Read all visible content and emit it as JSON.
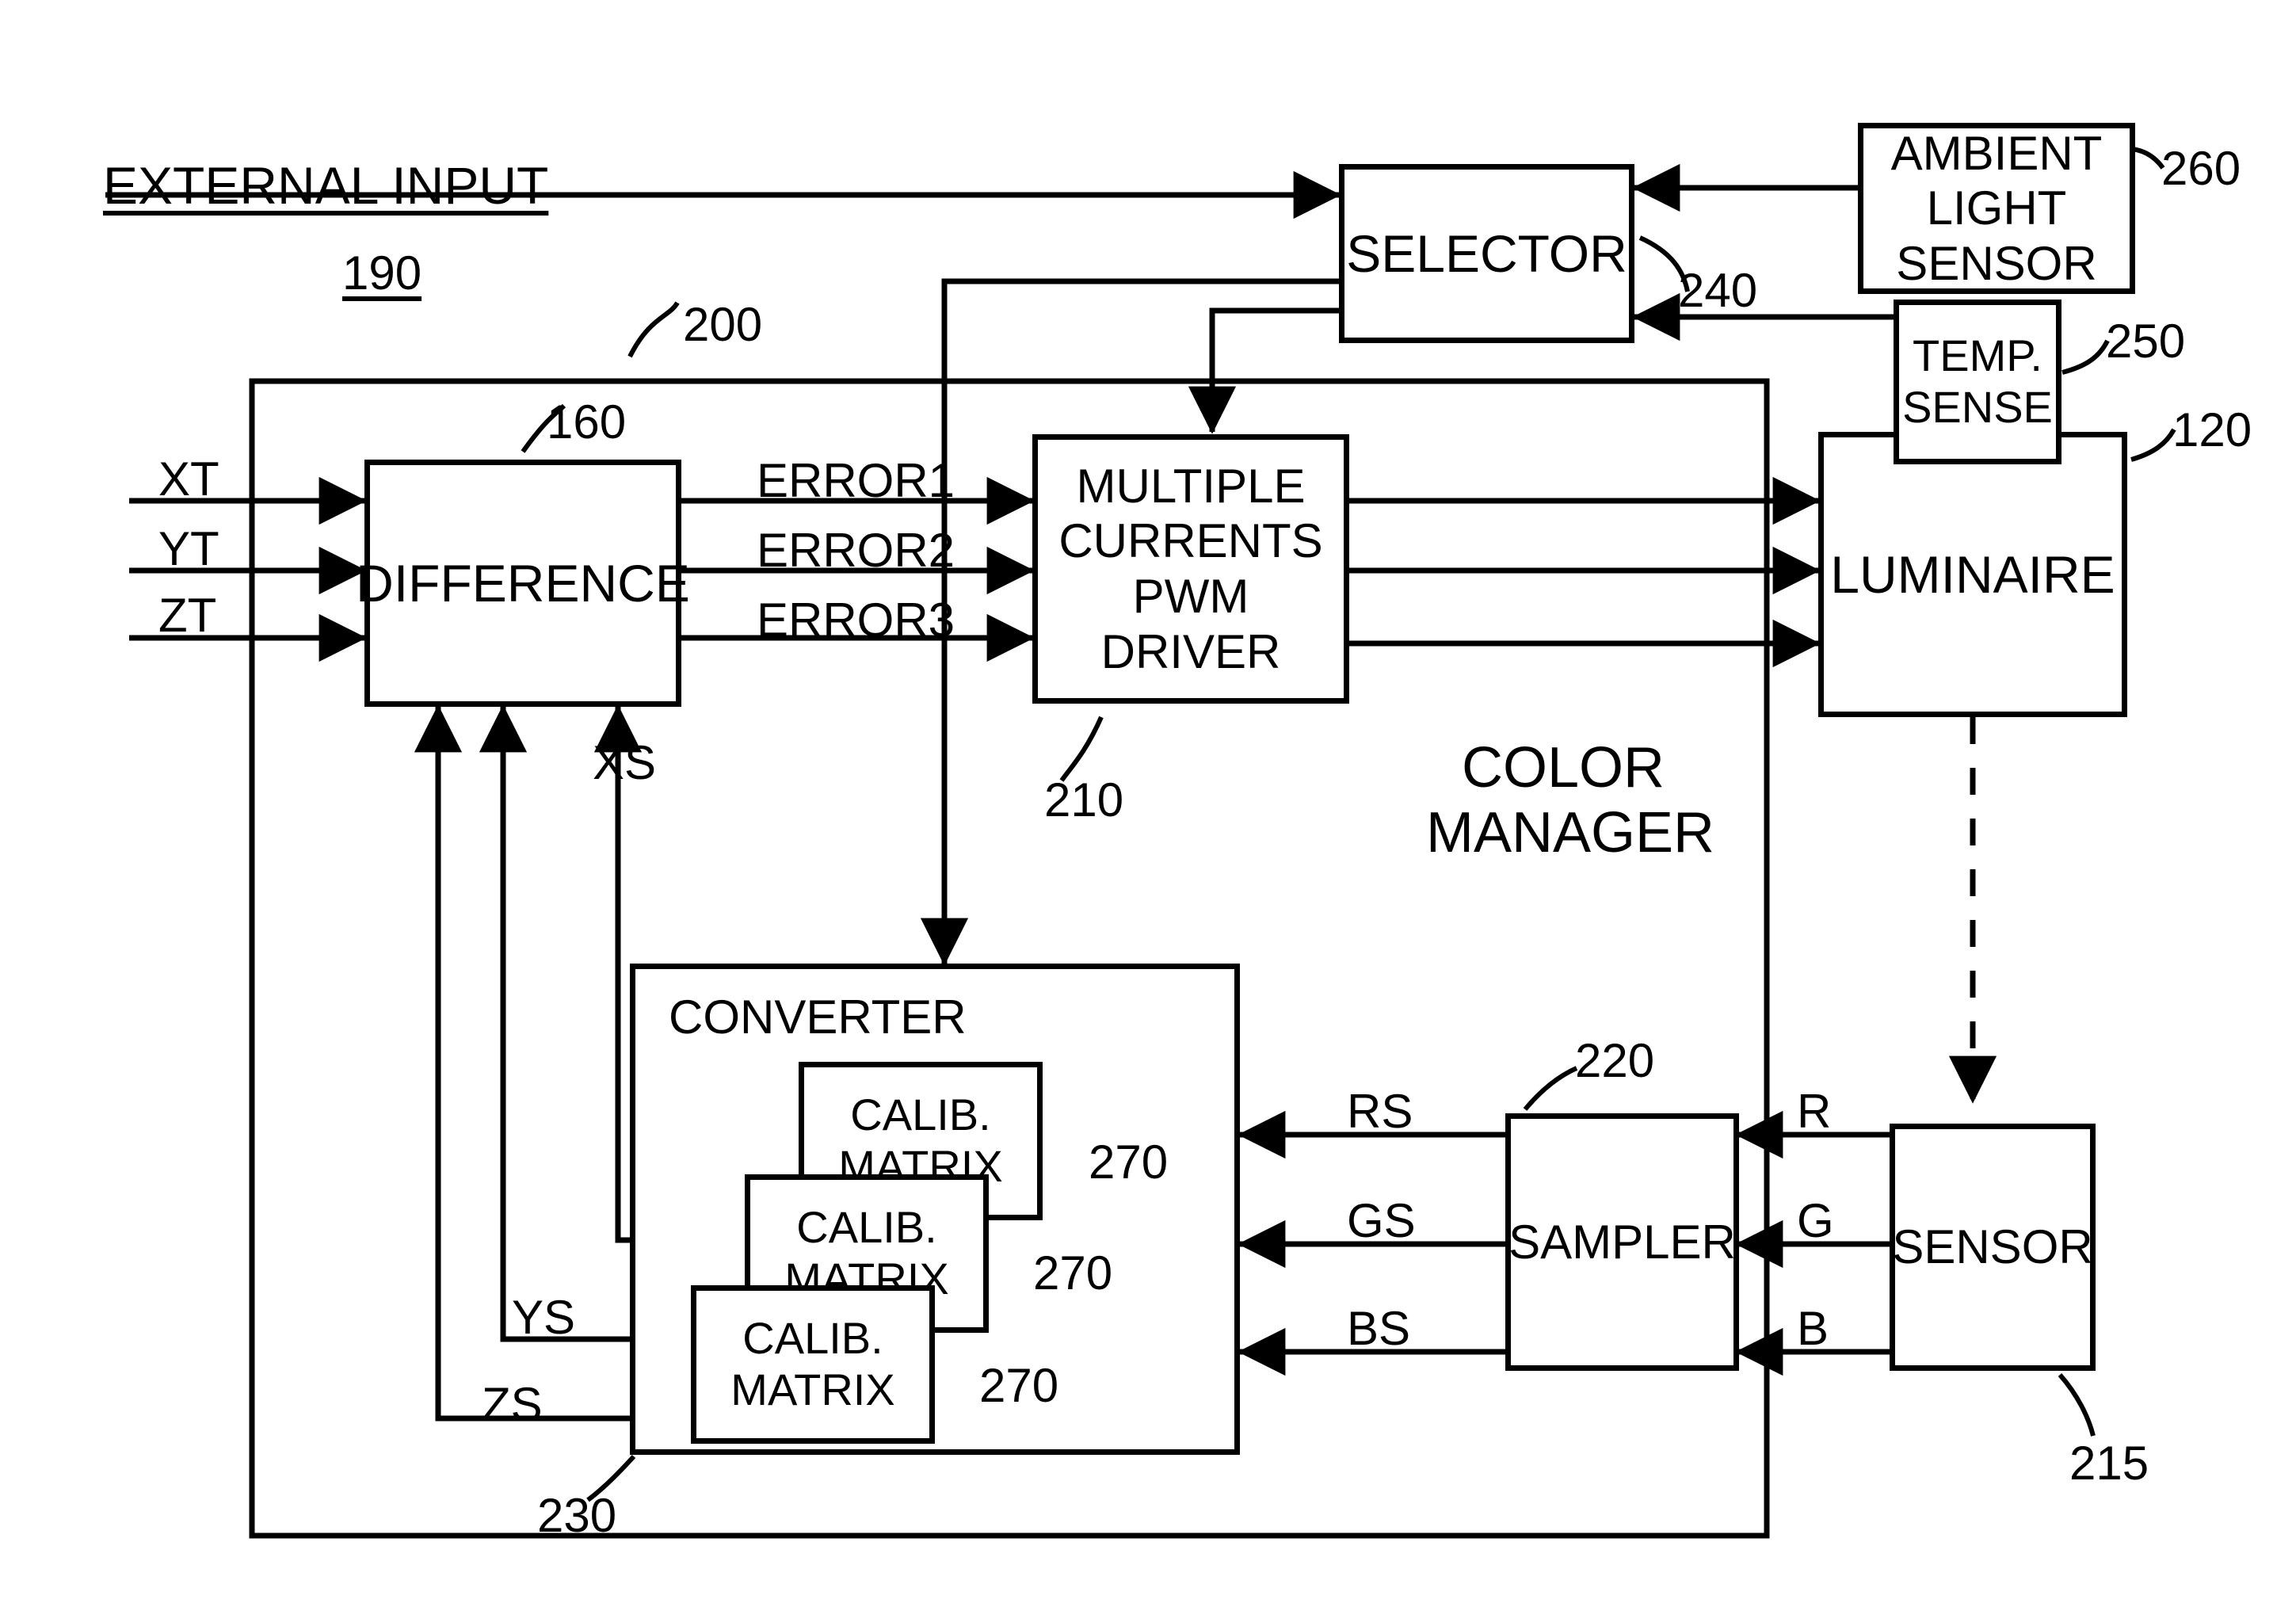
{
  "figure": {
    "external_input_label": "EXTERNAL INPUT",
    "ref_190": "190",
    "ref_200": "200",
    "color_manager_label_line1": "COLOR",
    "color_manager_label_line2": "MANAGER"
  },
  "blocks": {
    "difference": {
      "label": "DIFFERENCE",
      "ref": "160"
    },
    "pwm_driver": {
      "line1": "MULTIPLE",
      "line2": "CURRENTS",
      "line3": "PWM",
      "line4": "DRIVER",
      "ref": "210"
    },
    "selector": {
      "label": "SELECTOR",
      "ref": "240"
    },
    "ambient_light_sensor": {
      "line1": "AMBIENT",
      "line2": "LIGHT",
      "line3": "SENSOR",
      "ref": "260"
    },
    "temp_sense": {
      "line1": "TEMP.",
      "line2": "SENSE",
      "ref": "250"
    },
    "luminaire": {
      "label": "LUMINAIRE",
      "ref": "120"
    },
    "converter": {
      "label": "CONVERTER",
      "ref": "230"
    },
    "sampler": {
      "label": "SAMPLER",
      "ref": "220"
    },
    "sensor": {
      "label": "SENSOR",
      "ref": "215"
    },
    "calib_matrices": [
      {
        "line1": "CALIB.",
        "line2": "MATRIX",
        "ref": "270"
      },
      {
        "line1": "CALIB.",
        "line2": "MATRIX",
        "ref": "270"
      },
      {
        "line1": "CALIB.",
        "line2": "MATRIX",
        "ref": "270"
      }
    ]
  },
  "signals": {
    "inputs": [
      "XT",
      "YT",
      "ZT"
    ],
    "errors": [
      "ERROR1",
      "ERROR2",
      "ERROR3"
    ],
    "feedback": [
      "XS",
      "YS",
      "ZS"
    ],
    "sampled": [
      "RS",
      "GS",
      "BS"
    ],
    "rgb": [
      "R",
      "G",
      "B"
    ]
  },
  "colors": {
    "line": "#000000",
    "background": "#ffffff"
  }
}
